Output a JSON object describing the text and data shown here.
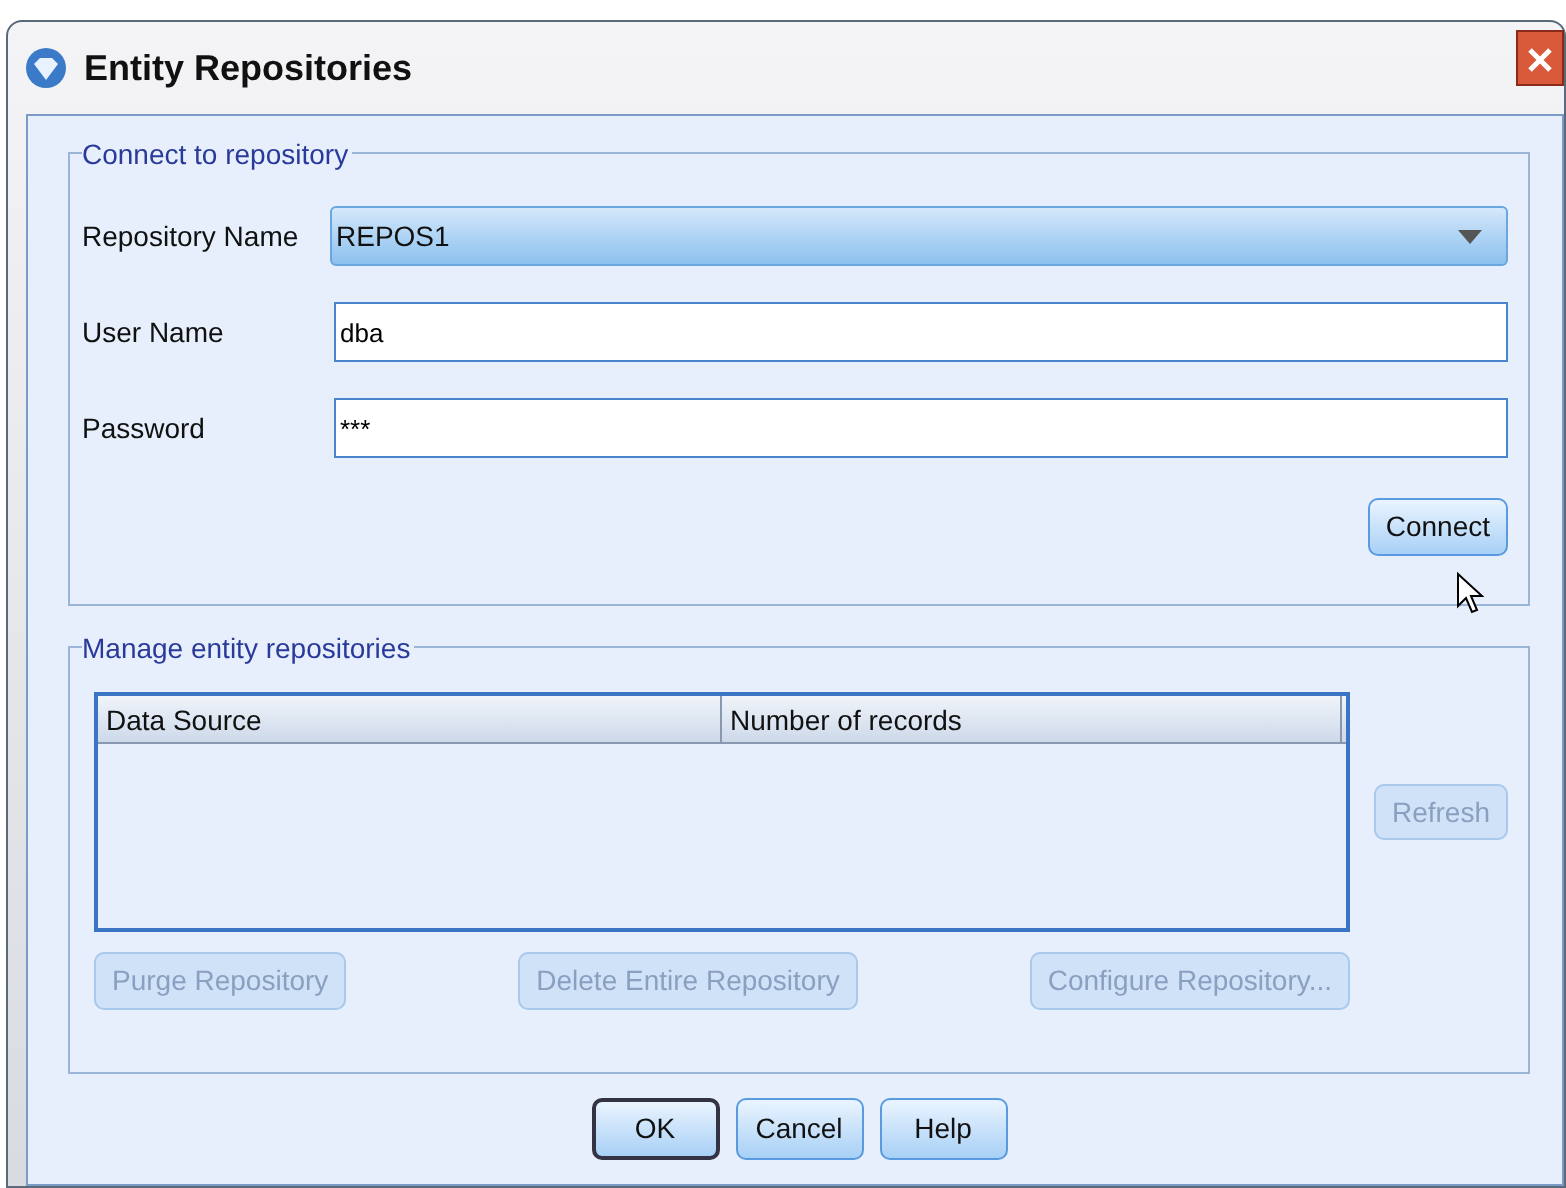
{
  "window": {
    "title": "Entity Repositories"
  },
  "connect_group": {
    "title": "Connect to repository",
    "fields": [
      {
        "kind": "dropdown",
        "label": "Repository Name",
        "value": "REPOS1"
      },
      {
        "kind": "text",
        "label": "User Name",
        "value": "dba"
      },
      {
        "kind": "password",
        "label": "Password",
        "value": "***"
      }
    ],
    "button": {
      "label": "Connect",
      "disabled": false
    }
  },
  "manage_group": {
    "title": "Manage entity repositories",
    "table": {
      "columns": [
        "Data Source",
        "Number of records"
      ]
    },
    "side_button": {
      "label": "Refresh",
      "disabled": true
    },
    "buttons": [
      {
        "label": "Purge Repository",
        "disabled": true
      },
      {
        "label": "Delete Entire Repository",
        "disabled": true
      },
      {
        "label": "Configure Repository...",
        "disabled": true
      }
    ]
  },
  "footer_buttons": [
    {
      "label": "OK",
      "default": true
    },
    {
      "label": "Cancel",
      "default": false
    },
    {
      "label": "Help",
      "default": false
    }
  ]
}
